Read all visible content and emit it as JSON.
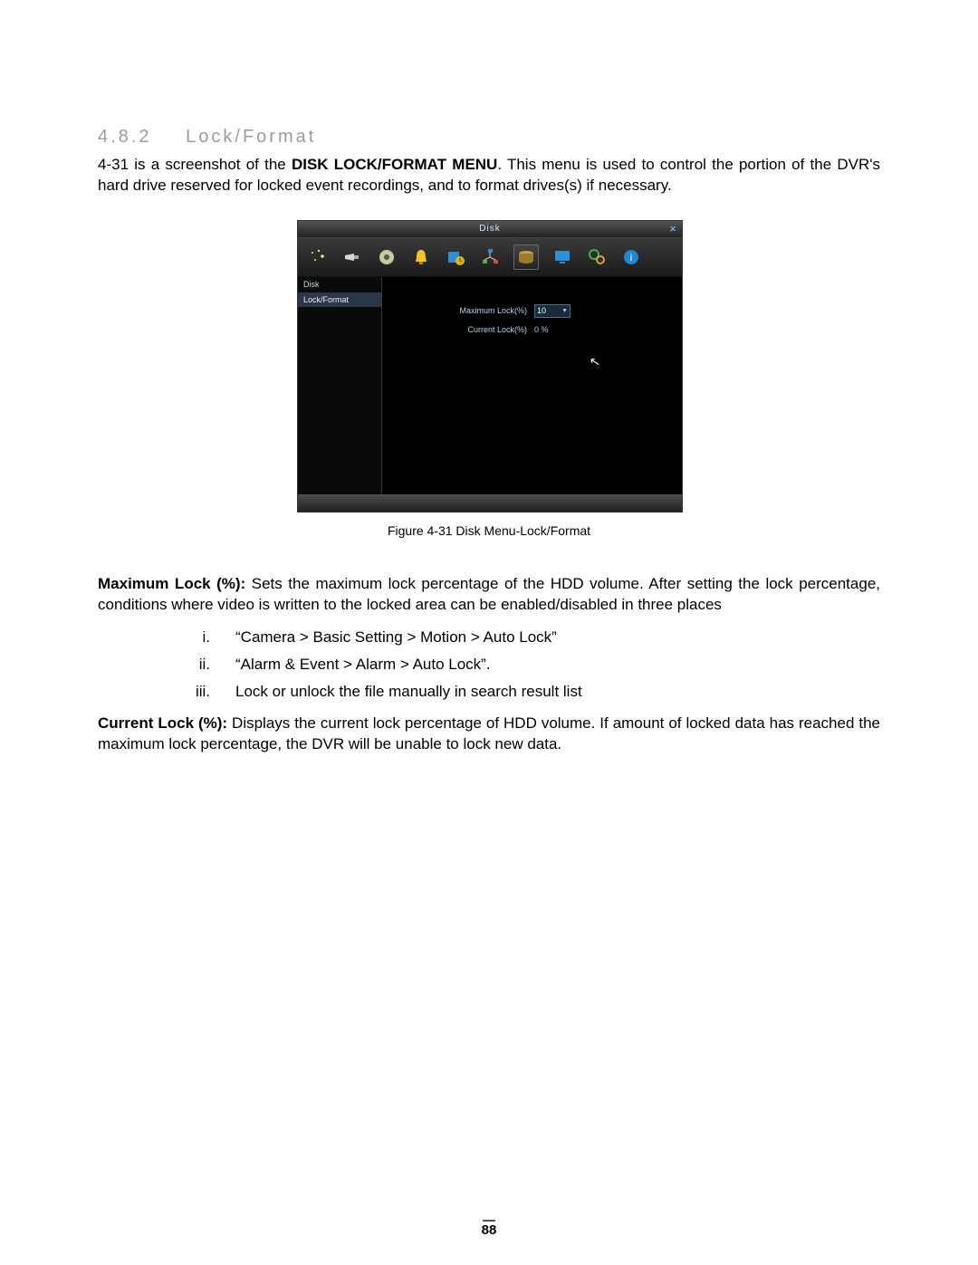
{
  "section": {
    "number": "4.8.2",
    "title": "Lock/Format"
  },
  "intro": {
    "pre": "4-31 is a screenshot of the ",
    "bold": "DISK LOCK/FORMAT MENU",
    "post": ". This menu is used to control the portion of the DVR's hard drive reserved for locked event recordings, and to format drives(s) if necessary."
  },
  "figure": {
    "title": "Disk",
    "nav": {
      "item1": "Disk",
      "item2": "Lock/Format"
    },
    "fields": {
      "max_label": "Maximum Lock(%)",
      "max_value": "10",
      "cur_label": "Current Lock(%)",
      "cur_value": "0 %"
    },
    "icons": {
      "i1": "wizard-icon",
      "i2": "camera-icon",
      "i3": "record-icon",
      "i4": "alarm-icon",
      "i5": "schedule-icon",
      "i6": "network-icon",
      "i7": "disk-icon",
      "i8": "display-icon",
      "i9": "settings-icon",
      "i10": "info-icon"
    },
    "caption": "Figure 4-31 Disk Menu-Lock/Format"
  },
  "maxlock": {
    "label": "Maximum Lock (%): ",
    "text": "Sets the maximum lock percentage of the HDD volume. After setting the lock percentage, conditions where video is written to the locked area can be enabled/disabled in three places"
  },
  "list": {
    "n1": "i.",
    "t1": "“Camera > Basic Setting > Motion > Auto Lock”",
    "n2": "ii.",
    "t2": "“Alarm & Event > Alarm > Auto Lock”.",
    "n3": "iii.",
    "t3": "Lock or unlock the file manually in search result list"
  },
  "curlock": {
    "label": "Current Lock (%): ",
    "text": "Displays the current lock percentage of HDD volume. If amount of locked data has reached the maximum lock percentage, the DVR will be unable to lock new data."
  },
  "page_number": "88"
}
